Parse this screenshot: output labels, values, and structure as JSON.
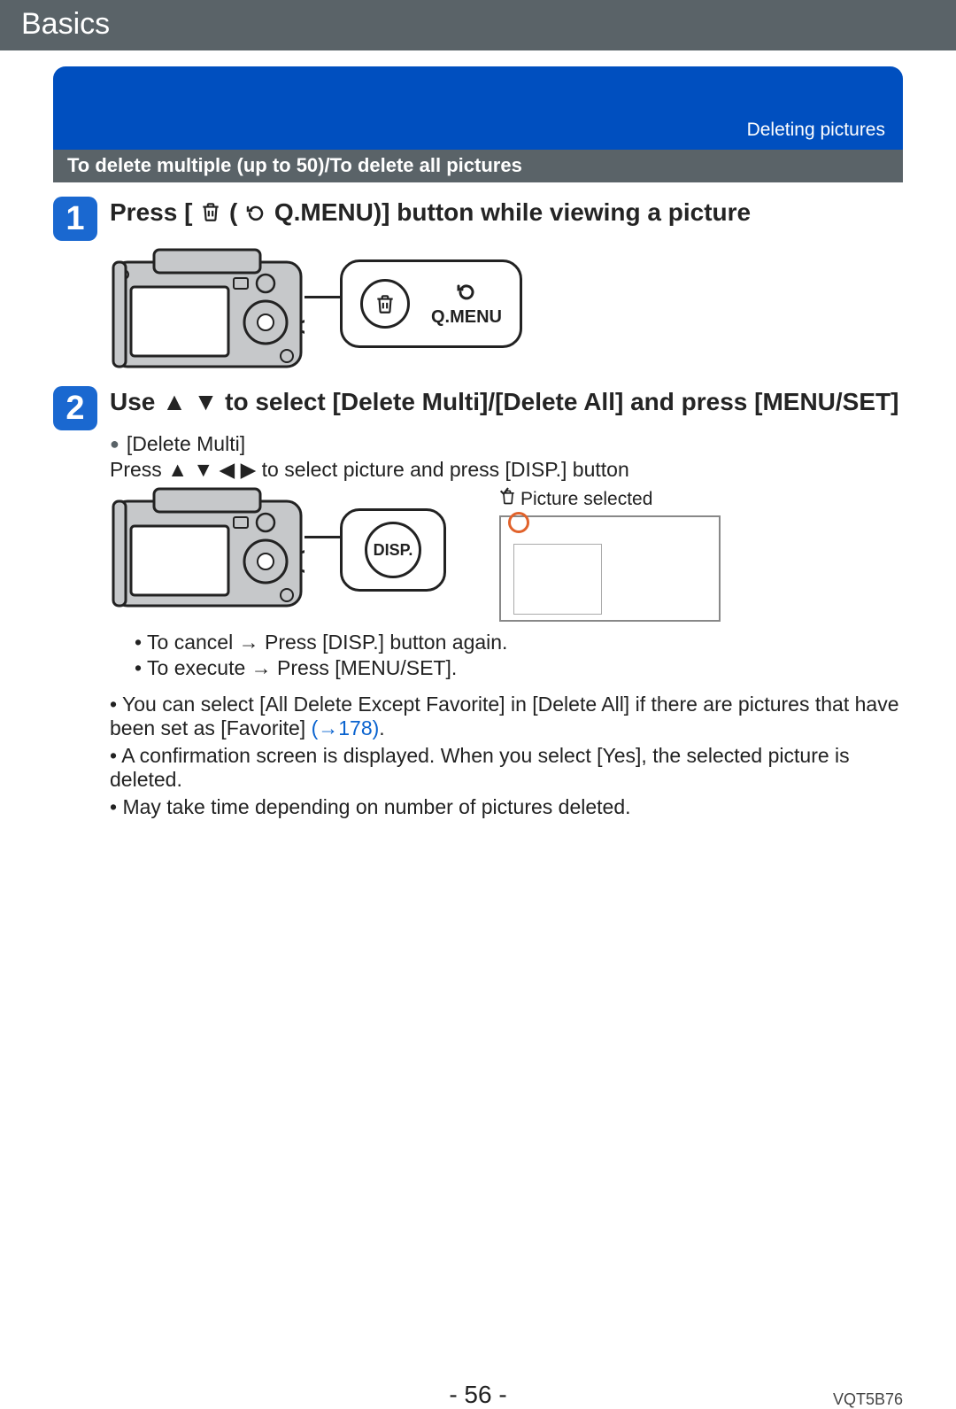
{
  "header": {
    "title": "Basics"
  },
  "banner": {
    "section": "Deleting pictures"
  },
  "subheader": "To delete multiple (up to 50)/To delete all pictures",
  "steps": [
    {
      "num": "1",
      "title_pre": "Press [",
      "title_post": " Q.MENU)] button while viewing a picture",
      "qmenu_label": "Q.MENU"
    },
    {
      "num": "2",
      "title_pre": "Use ",
      "title_mid": " to select [Delete Multi]/[Delete All] and press [MENU/SET]",
      "delete_multi_label": "[Delete Multi]",
      "press_line_pre": "Press ",
      "press_line_post": " to select picture and press [DISP.] button",
      "disp_label": "DISP.",
      "picture_selected_label": "Picture selected",
      "cancel_line": "To cancel → Press [DISP.] button again.",
      "execute_line": "To execute → Press [MENU/SET]."
    }
  ],
  "notes": [
    {
      "pre": "You can select [All Delete Except Favorite] in [Delete All] if there are pictures that have been set as [Favorite] ",
      "link": "(→178)",
      "post": "."
    },
    {
      "pre": "A confirmation screen is displayed. When you select [Yes], the selected picture is deleted.",
      "link": "",
      "post": ""
    },
    {
      "pre": "May take time depending on number of pictures deleted.",
      "link": "",
      "post": ""
    }
  ],
  "footer": {
    "page": "- 56 -",
    "doc_id": "VQT5B76"
  }
}
